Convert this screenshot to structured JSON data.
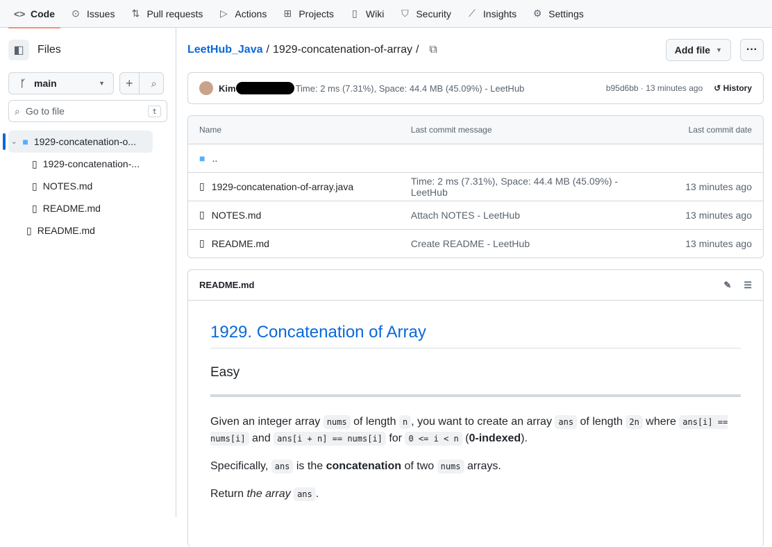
{
  "nav": {
    "tabs": [
      {
        "label": "Code",
        "icon": "code-icon"
      },
      {
        "label": "Issues"
      },
      {
        "label": "Pull requests"
      },
      {
        "label": "Actions"
      },
      {
        "label": "Projects"
      },
      {
        "label": "Wiki"
      },
      {
        "label": "Security"
      },
      {
        "label": "Insights"
      },
      {
        "label": "Settings"
      }
    ]
  },
  "sidebar": {
    "title": "Files",
    "branch": "main",
    "search_placeholder": "Go to file",
    "shortcut": "t",
    "tree": [
      "1929-concatenation-o...",
      "1929-concatenation-...",
      "NOTES.md",
      "README.md",
      "README.md"
    ]
  },
  "breadcrumb": {
    "repo": "LeetHub_Java",
    "sep": "/",
    "folder": "1929-concatenation-of-array",
    "trail": "/"
  },
  "add_file": "Add file",
  "commit": {
    "author": "Kim",
    "message": "Time: 2 ms (7.31%), Space: 44.4 MB (45.09%) - LeetHub",
    "meta": "b95d6bb · 13 minutes ago",
    "history": "History"
  },
  "table": {
    "headers": [
      "Name",
      "Last commit message",
      "Last commit date"
    ],
    "parent": "..",
    "rows": [
      {
        "name": "1929-concatenation-of-array.java",
        "msg": "Time: 2 ms (7.31%), Space: 44.4 MB (45.09%) - LeetHub",
        "date": "13 minutes ago"
      },
      {
        "name": "NOTES.md",
        "msg": "Attach NOTES - LeetHub",
        "date": "13 minutes ago"
      },
      {
        "name": "README.md",
        "msg": "Create README - LeetHub",
        "date": "13 minutes ago"
      }
    ]
  },
  "readme": {
    "file": "README.md",
    "title": "1929. Concatenation of Array",
    "difficulty": "Easy",
    "p1": [
      "Given an integer array ",
      "nums",
      " of length ",
      "n",
      ", you want to create an array ",
      "ans",
      " of length ",
      "2n",
      " where ",
      "ans[i] == nums[i]",
      " and ",
      "ans[i + n] == nums[i]",
      " for ",
      "0 <= i < n",
      " (",
      "0-indexed",
      ")."
    ],
    "p2": [
      "Specifically, ",
      "ans",
      " is the ",
      "concatenation",
      " of two ",
      "nums",
      " arrays."
    ],
    "p3": [
      "Return ",
      "the array",
      " ",
      "ans",
      "."
    ]
  }
}
